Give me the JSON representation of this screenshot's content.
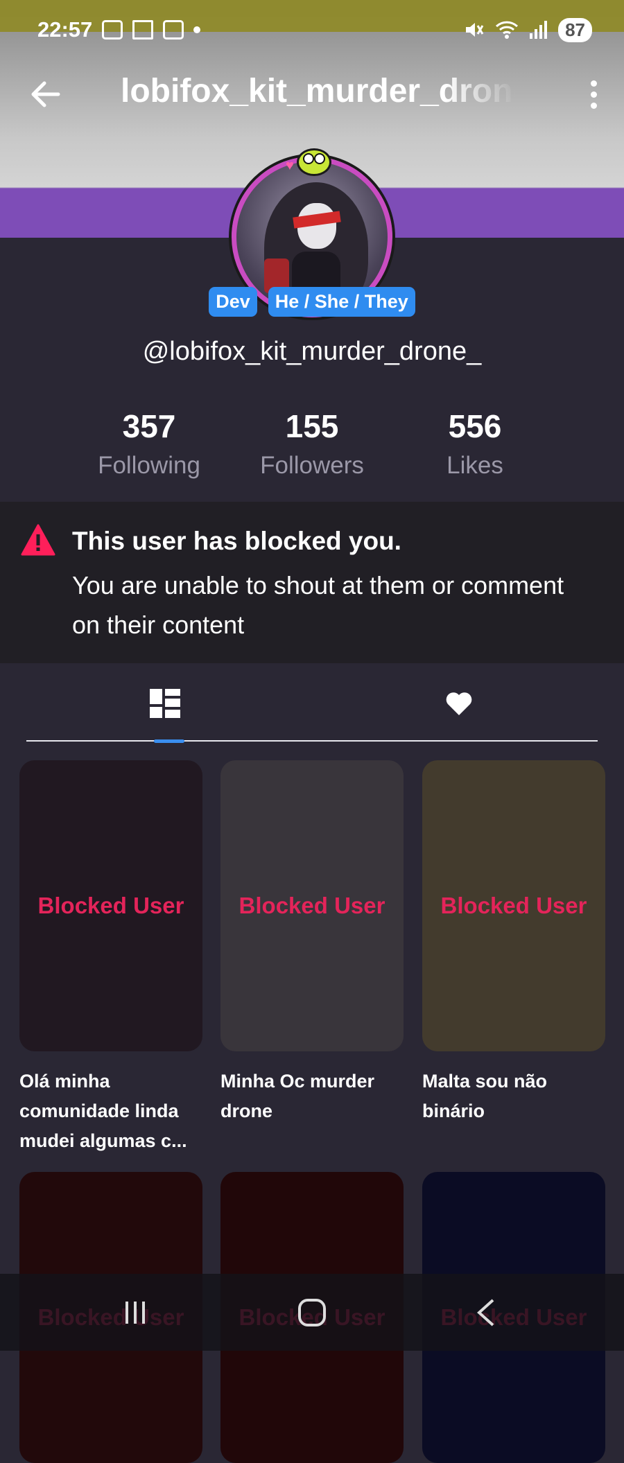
{
  "status_bar": {
    "time": "22:57",
    "battery": "87",
    "network_sub": "5"
  },
  "header": {
    "title": "lobifox_kit_murder_drone_",
    "back_icon": "arrow-left-icon",
    "menu_icon": "more-vert-icon"
  },
  "profile": {
    "badges": [
      "Dev",
      "He / She / They"
    ],
    "handle": "@lobifox_kit_murder_drone_",
    "stats": [
      {
        "value": "357",
        "label": "Following"
      },
      {
        "value": "155",
        "label": "Followers"
      },
      {
        "value": "556",
        "label": "Likes"
      }
    ]
  },
  "blocked_notice": {
    "title": "This user has blocked you.",
    "message": "You are unable to shout at them or comment on their content",
    "icon": "warning-triangle-icon",
    "icon_color": "#ff1f5a"
  },
  "tabs": {
    "items": [
      {
        "icon": "grid-icon"
      },
      {
        "icon": "heart-icon"
      }
    ],
    "active_color": "#3a8ff0"
  },
  "posts": [
    {
      "label": "Blocked User",
      "caption": "Olá minha comunidade linda mudei algumas c...",
      "bg": "#211821"
    },
    {
      "label": "Blocked User",
      "caption": "Minha Oc murder drone",
      "bg": "#39353b"
    },
    {
      "label": "Blocked User",
      "caption": "Malta sou não binário",
      "bg": "#433b2d"
    },
    {
      "label": "Blocked User",
      "caption": "",
      "bg": "#22090b"
    },
    {
      "label": "Blocked User",
      "caption": "",
      "bg": "#210709"
    },
    {
      "label": "Blocked User",
      "caption": "",
      "bg": "#0b0c24"
    }
  ],
  "blocked_label_color": "#e4245a",
  "nav_bar": {
    "buttons": [
      "recents-icon",
      "home-icon",
      "back-chevron-icon"
    ]
  }
}
